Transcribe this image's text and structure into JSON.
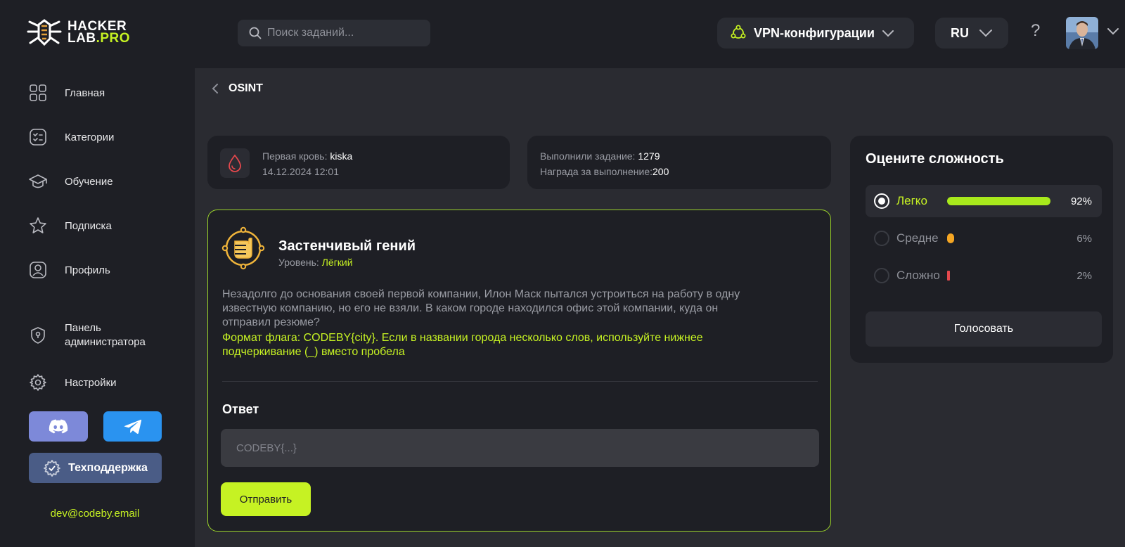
{
  "header": {
    "logo": {
      "line1": "HACKER",
      "line2a": "LAB",
      "line2b": ".PRO"
    },
    "search_placeholder": "Поиск заданий...",
    "vpn_label": "VPN-конфигурации",
    "lang_label": "RU",
    "help_label": "?"
  },
  "sidebar": {
    "items": [
      {
        "label": "Главная"
      },
      {
        "label": "Категории"
      },
      {
        "label": "Обучение"
      },
      {
        "label": "Подписка"
      },
      {
        "label": "Профиль"
      },
      {
        "label": "Панель администратора"
      },
      {
        "label": "Настройки"
      }
    ],
    "support_label": "Техподдержка",
    "email": "dev@codeby.email"
  },
  "breadcrumb": {
    "label": "OSINT"
  },
  "first_blood": {
    "label": "Первая кровь:",
    "user": "kiska",
    "date": "14.12.2024 12:01"
  },
  "stats": {
    "solved_label": "Выполнили задание:",
    "solved_value": "1279",
    "reward_label": "Награда за выполнение:",
    "reward_value": "200"
  },
  "task": {
    "title": "Застенчивый гений",
    "level_label": "Уровень:",
    "level_value": "Лёгкий",
    "description": "Незадолго до основания своей первой компании, Илон Маск пытался устроиться на работу в одну известную компанию, но его не взяли. В каком городе находился офис этой компании, куда он отправил резюме?",
    "flag_format": "Формат флага: CODEBY{city}. Если в названии города несколько слов, используйте нижнее подчеркивание (_) вместо пробела",
    "answer_label": "Ответ",
    "answer_placeholder": "CODEBY{...}",
    "submit_label": "Отправить"
  },
  "rating": {
    "title": "Оцените сложность",
    "options": [
      {
        "label": "Легко",
        "percent_text": "92%",
        "percent": 92,
        "color": "#a8e91c",
        "selected": true
      },
      {
        "label": "Средне",
        "percent_text": "6%",
        "percent": 6,
        "color": "#f5a623",
        "selected": false
      },
      {
        "label": "Сложно",
        "percent_text": "2%",
        "percent": 2,
        "color": "#e5484d",
        "selected": false
      }
    ],
    "vote_label": "Голосовать"
  },
  "colors": {
    "accent": "#c6f223",
    "bg_dark": "#1e1f25",
    "bg_main": "#2a2b31",
    "discord": "#7d89d9",
    "telegram": "#2a93f0",
    "support": "#4a5c86"
  }
}
